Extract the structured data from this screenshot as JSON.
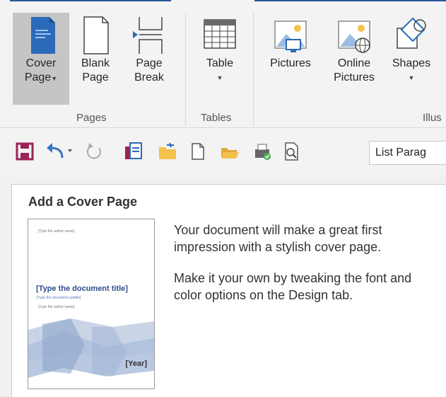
{
  "ribbon": {
    "buttons": {
      "cover_page": {
        "line1": "Cover",
        "line2": "Page"
      },
      "blank_page": {
        "line1": "Blank",
        "line2": "Page"
      },
      "page_break": {
        "line1": "Page",
        "line2": "Break"
      },
      "table": {
        "line1": "Table"
      },
      "pictures": {
        "line1": "Pictures"
      },
      "online_pictures": {
        "line1": "Online",
        "line2": "Pictures"
      },
      "shapes": {
        "line1": "Shapes"
      }
    },
    "groups": {
      "pages": "Pages",
      "tables": "Tables",
      "illustrations": "Illus"
    }
  },
  "qat": {
    "style_value": "List Parag"
  },
  "tooltip": {
    "title": "Add a Cover Page",
    "paragraph1": "Your document will make a great first impression with a stylish cover page.",
    "paragraph2": "Make it your own by tweaking the font and color options on the Design tab.",
    "thumbnail": {
      "author_top": "[Type the author name]",
      "doc_title": "[Type the document title]",
      "doc_subtitle": "[Type the document subtitle]",
      "author_bottom": "[Type the author name]",
      "year": "[Year]"
    }
  },
  "colors": {
    "accent": "#2b579a",
    "save": "#9b2257",
    "undo": "#3b74c2",
    "folder": "#f2c14e"
  }
}
